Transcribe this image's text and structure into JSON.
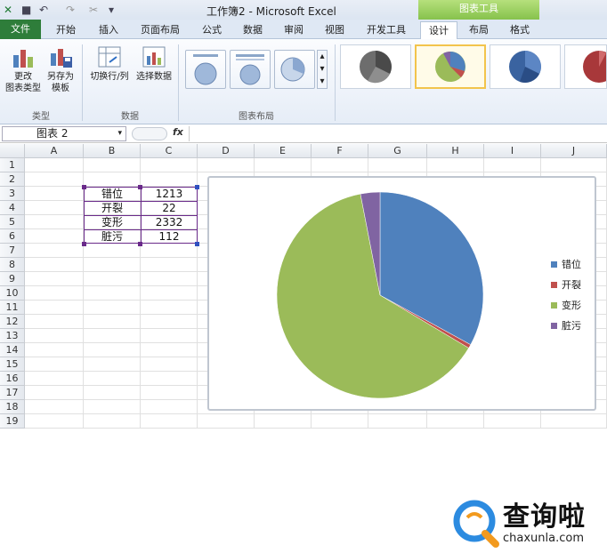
{
  "window": {
    "title": "工作簿2 - Microsoft Excel",
    "context_tab_group": "图表工具"
  },
  "tabs": [
    "文件",
    "开始",
    "插入",
    "页面布局",
    "公式",
    "数据",
    "审阅",
    "视图",
    "开发工具",
    "设计",
    "布局",
    "格式"
  ],
  "ribbon": {
    "change_type": "更改\n图表类型",
    "save_template": "另存为\n模板",
    "switch_rowcol": "切换行/列",
    "select_data": "选择数据",
    "group_type": "类型",
    "group_data": "数据",
    "group_layout": "图表布局"
  },
  "formula_bar": {
    "name_box": "图表 2",
    "fx": "fx",
    "formula": ""
  },
  "columns": [
    "A",
    "B",
    "C",
    "D",
    "E",
    "F",
    "G",
    "H",
    "I",
    "J"
  ],
  "rows": [
    "1",
    "2",
    "3",
    "4",
    "5",
    "6",
    "7",
    "8",
    "9",
    "10",
    "11",
    "12",
    "13",
    "14",
    "15",
    "16",
    "17",
    "18",
    "19"
  ],
  "table": [
    {
      "label": "错位",
      "value": "1213"
    },
    {
      "label": "开裂",
      "value": "22"
    },
    {
      "label": "变形",
      "value": "2332"
    },
    {
      "label": "脏污",
      "value": "112"
    }
  ],
  "colors": {
    "series": [
      "#4f81bd",
      "#c0504d",
      "#9bbb59",
      "#8064a2"
    ],
    "file_tab": "#2e7d3a",
    "context_tab": "#86c24c"
  },
  "chart_data": {
    "type": "pie",
    "categories": [
      "错位",
      "开裂",
      "变形",
      "脏污"
    ],
    "values": [
      1213,
      22,
      2332,
      112
    ],
    "legend_position": "right"
  },
  "watermark": {
    "text": "查询啦",
    "url": "chaxunla.com"
  }
}
